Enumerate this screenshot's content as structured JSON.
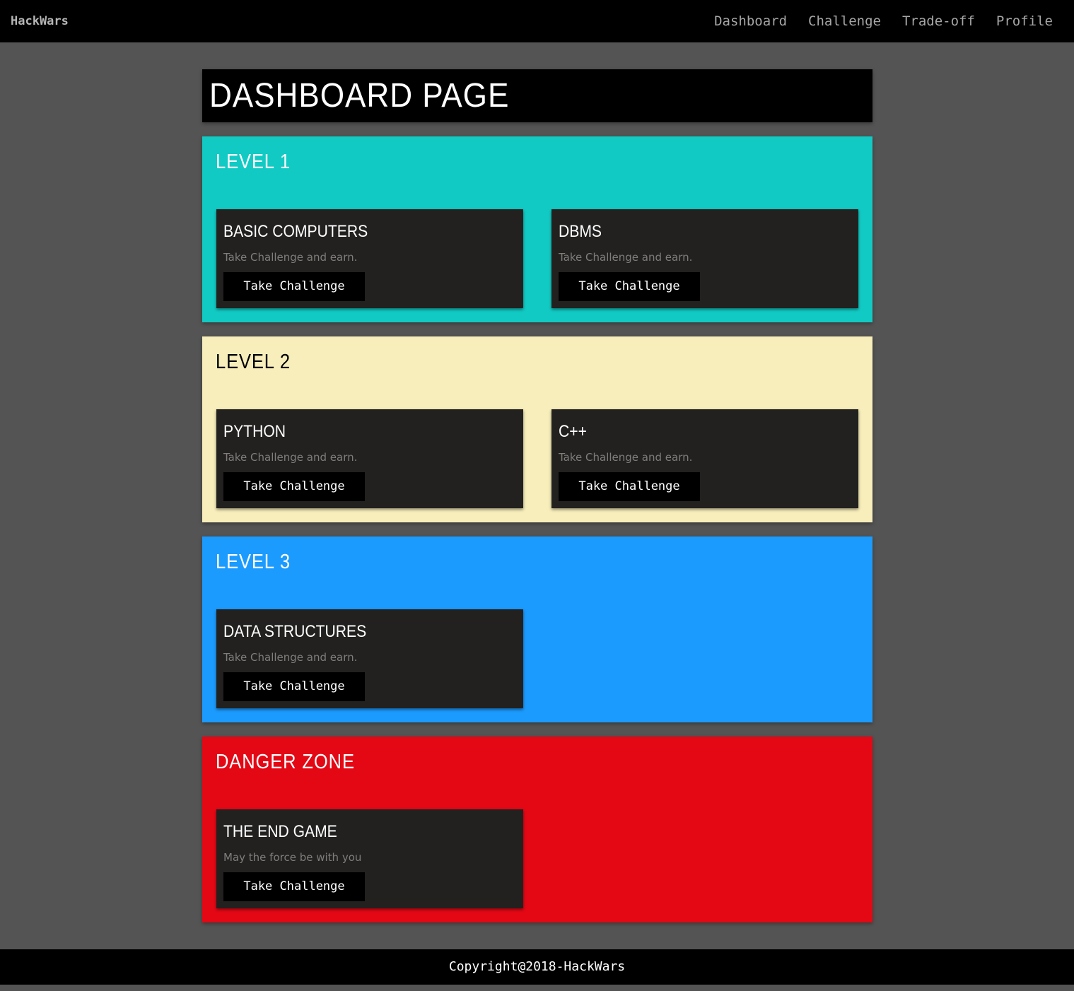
{
  "navbar": {
    "brand": "HackWars",
    "links": [
      "Dashboard",
      "Challenge",
      "Trade-off",
      "Profile"
    ]
  },
  "page_title": "DASHBOARD PAGE",
  "levels": [
    {
      "title": "LEVEL 1",
      "background": "#12cac4",
      "title_color": "#ffffff",
      "cards": [
        {
          "title": "BASIC COMPUTERS",
          "text": "Take Challenge and earn.",
          "button": "Take Challenge"
        },
        {
          "title": "DBMS",
          "text": "Take Challenge and earn.",
          "button": "Take Challenge"
        }
      ]
    },
    {
      "title": "LEVEL 2",
      "background": "#f8eebb",
      "title_color": "#000000",
      "cards": [
        {
          "title": "PYTHON",
          "text": "Take Challenge and earn.",
          "button": "Take Challenge"
        },
        {
          "title": "C++",
          "text": "Take Challenge and earn.",
          "button": "Take Challenge"
        }
      ]
    },
    {
      "title": "LEVEL 3",
      "background": "#1c9bfe",
      "title_color": "#ffffff",
      "cards": [
        {
          "title": "DATA STRUCTURES",
          "text": "Take Challenge and earn.",
          "button": "Take Challenge"
        }
      ]
    },
    {
      "title": "DANGER ZONE",
      "background": "#e40815",
      "title_color": "#ffffff",
      "cards": [
        {
          "title": "THE END GAME",
          "text": "May the force be with you",
          "button": "Take Challenge"
        }
      ]
    }
  ],
  "footer": {
    "text": "Copyright@2018-HackWars"
  }
}
